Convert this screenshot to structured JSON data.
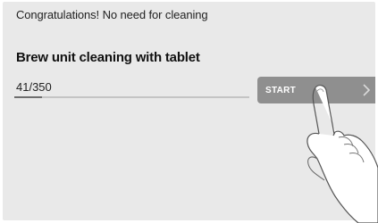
{
  "status": {
    "message": "Congratulations! No need for cleaning"
  },
  "cleaning": {
    "title": "Brew unit cleaning with tablet",
    "counter": "41/350",
    "progress_fraction": 0.117
  },
  "start_button": {
    "label": "START",
    "icon": "chevron-right-icon"
  },
  "illustration": {
    "icon": "pointing-hand-icon"
  },
  "colors": {
    "screen_background": "#e9e9e9",
    "button_background": "#8f8f8f",
    "progress_track": "#c4c4c4",
    "progress_fill": "#6e6e6e"
  }
}
